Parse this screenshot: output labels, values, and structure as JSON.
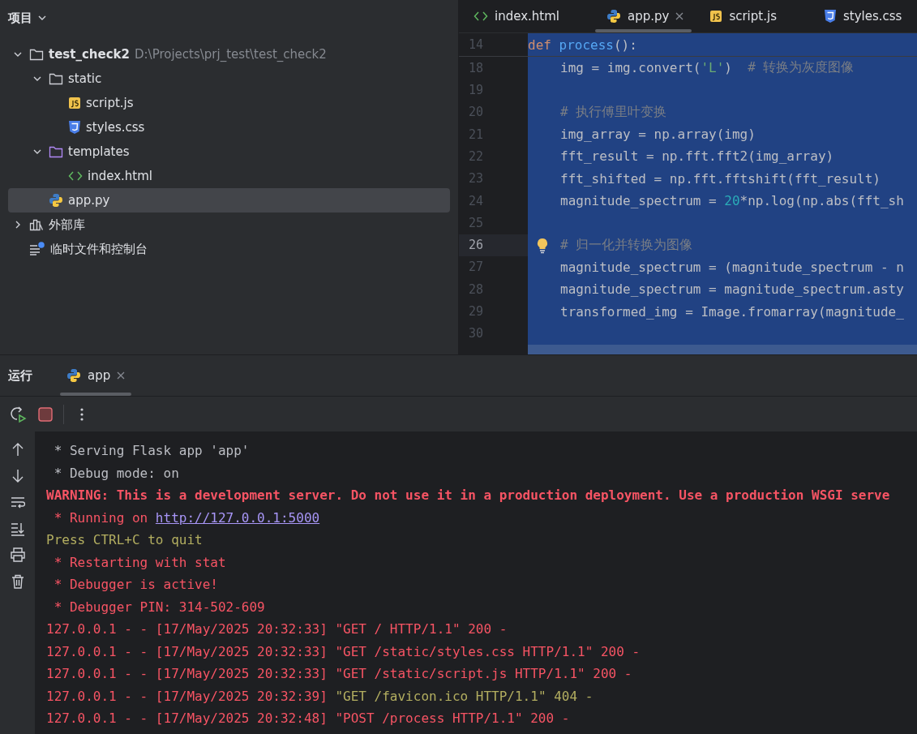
{
  "project": {
    "title": "项目",
    "tree": [
      {
        "label": "test_check2",
        "path": "D:\\Projects\\prj_test\\test_check2",
        "kind": "folder",
        "expanded": true,
        "selected": false,
        "children": [
          {
            "label": "static",
            "kind": "folder",
            "expanded": true,
            "selected": false,
            "children": [
              {
                "label": "script.js",
                "kind": "js",
                "selected": false
              },
              {
                "label": "styles.css",
                "kind": "css",
                "selected": false
              }
            ]
          },
          {
            "label": "templates",
            "kind": "template-folder",
            "expanded": true,
            "selected": false,
            "children": [
              {
                "label": "index.html",
                "kind": "html",
                "selected": false
              }
            ]
          },
          {
            "label": "app.py",
            "kind": "py",
            "selected": true
          }
        ]
      },
      {
        "label": "外部库",
        "kind": "library",
        "expanded": false,
        "selected": false
      },
      {
        "label": "临时文件和控制台",
        "kind": "scratch",
        "selected": false
      }
    ]
  },
  "editor": {
    "tabs": [
      {
        "label": "index.html",
        "kind": "html",
        "selected": false
      },
      {
        "label": "app.py",
        "kind": "py",
        "selected": true
      },
      {
        "label": "script.js",
        "kind": "js",
        "selected": false
      },
      {
        "label": "styles.css",
        "kind": "css",
        "selected": false
      }
    ],
    "sticky": {
      "number": "14",
      "tokens": [
        {
          "text": "def ",
          "kind": "keyword"
        },
        {
          "text": "process",
          "kind": "function"
        },
        {
          "text": "():",
          "kind": "plain"
        }
      ]
    },
    "lines": [
      {
        "number": "18",
        "current": false,
        "tokens": [
          {
            "text": "img = img.convert(",
            "kind": "plain"
          },
          {
            "text": "'L'",
            "kind": "string"
          },
          {
            "text": ")  ",
            "kind": "plain"
          },
          {
            "text": "# 转换为灰度图像",
            "kind": "comment"
          }
        ]
      },
      {
        "number": "19",
        "current": false
      },
      {
        "number": "20",
        "current": false,
        "tokens": [
          {
            "text": "# 执行傅里叶变换",
            "kind": "comment"
          }
        ]
      },
      {
        "number": "21",
        "current": false,
        "tokens": [
          {
            "text": "img_array = np.array(img)",
            "kind": "plain"
          }
        ]
      },
      {
        "number": "22",
        "current": false,
        "tokens": [
          {
            "text": "fft_result = np.fft.fft2(img_array)",
            "kind": "plain"
          }
        ]
      },
      {
        "number": "23",
        "current": false,
        "tokens": [
          {
            "text": "fft_shifted = np.fft.fftshift(fft_result)",
            "kind": "plain"
          }
        ]
      },
      {
        "number": "24",
        "current": false,
        "tokens": [
          {
            "text": "magnitude_spectrum = ",
            "kind": "plain"
          },
          {
            "text": "20",
            "kind": "number"
          },
          {
            "text": "*np.log(np.abs(fft_sh",
            "kind": "plain"
          }
        ]
      },
      {
        "number": "25",
        "current": false
      },
      {
        "number": "26",
        "current": true,
        "tokens": [
          {
            "text": "# 归一化并转换为图像",
            "kind": "comment"
          }
        ]
      },
      {
        "number": "27",
        "current": false,
        "tokens": [
          {
            "text": "magnitude_spectrum = (magnitude_spectrum - n",
            "kind": "plain"
          }
        ]
      },
      {
        "number": "28",
        "current": false,
        "tokens": [
          {
            "text": "magnitude_spectrum = magnitude_spectrum.asty",
            "kind": "plain"
          }
        ]
      },
      {
        "number": "29",
        "current": false,
        "tokens": [
          {
            "text": "transformed_img = Image.fromarray(magnitude_",
            "kind": "plain"
          }
        ]
      },
      {
        "number": "30",
        "current": false
      }
    ]
  },
  "run": {
    "title": "运行",
    "tabs": [
      {
        "label": "app",
        "selected": true
      }
    ],
    "console": [
      [
        {
          "text": " * Serving Flask app 'app'",
          "kind": "plain"
        }
      ],
      [
        {
          "text": " * Debug mode: on",
          "kind": "plain"
        }
      ],
      [
        {
          "text": "WARNING: This is a development server. Do not use it in a production deployment. Use a production WSGI serve",
          "kind": "error-bold"
        }
      ],
      [
        {
          "text": " * Running on ",
          "kind": "error"
        },
        {
          "text": "http://127.0.0.1:5000",
          "kind": "link"
        }
      ],
      [
        {
          "text": "Press CTRL+C to quit",
          "kind": "warn"
        }
      ],
      [
        {
          "text": " * Restarting with stat",
          "kind": "error"
        }
      ],
      [
        {
          "text": " * Debugger is active!",
          "kind": "error"
        }
      ],
      [
        {
          "text": " * Debugger PIN: 314-502-609",
          "kind": "error"
        }
      ],
      [
        {
          "text": "127.0.0.1 - - [17/May/2025 20:32:33] \"GET / HTTP/1.1\" 200 -",
          "kind": "error"
        }
      ],
      [
        {
          "text": "127.0.0.1 - - [17/May/2025 20:32:33] \"GET /static/styles.css HTTP/1.1\" 200 -",
          "kind": "error"
        }
      ],
      [
        {
          "text": "127.0.0.1 - - [17/May/2025 20:32:33] \"GET /static/script.js HTTP/1.1\" 200 -",
          "kind": "error"
        }
      ],
      [
        {
          "text": "127.0.0.1 - - [17/May/2025 20:32:39] ",
          "kind": "error"
        },
        {
          "text": "\"GET /favicon.ico HTTP/1.1\" 404 -",
          "kind": "warn"
        }
      ],
      [
        {
          "text": "127.0.0.1 - - [17/May/2025 20:32:48] \"POST /process HTTP/1.1\" 200 -",
          "kind": "error"
        }
      ]
    ]
  }
}
